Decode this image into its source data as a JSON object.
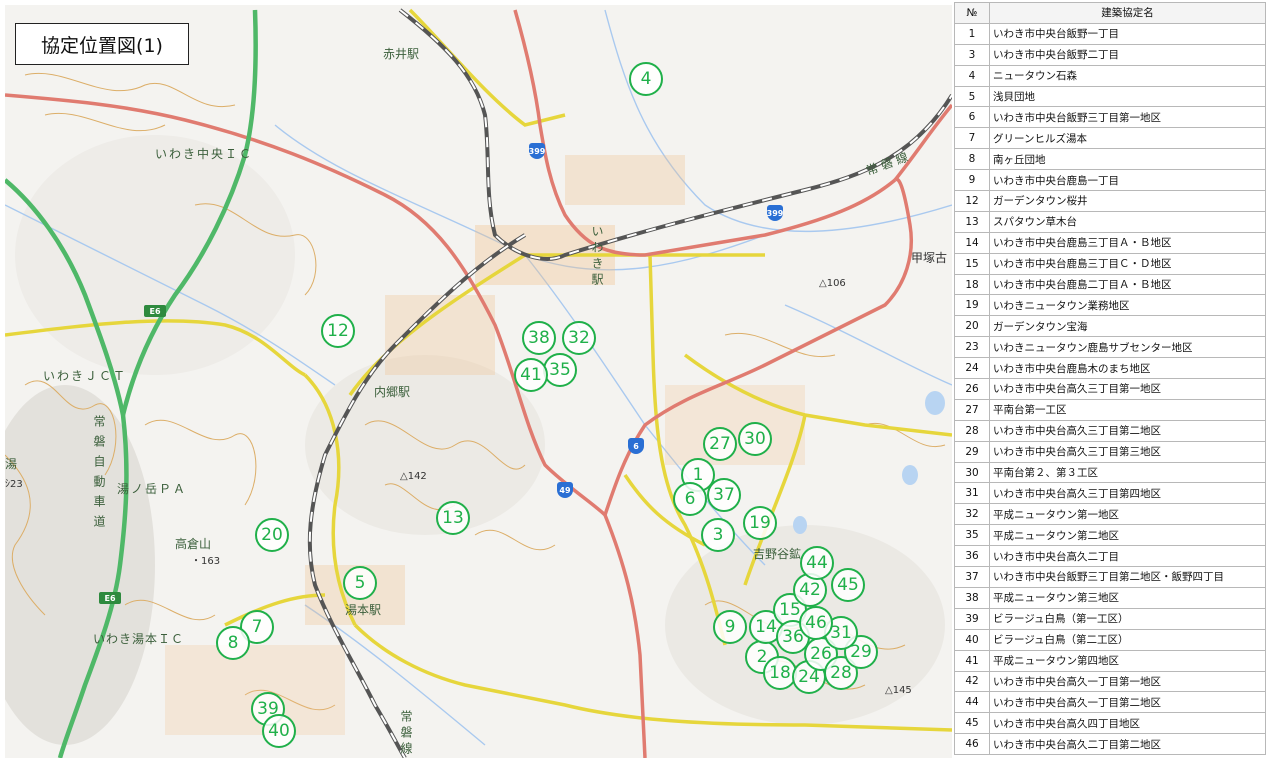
{
  "map": {
    "title": "協定位置図(1)",
    "place_labels": [
      {
        "id": "akai-station",
        "text": "赤井駅"
      },
      {
        "id": "iwaki-chuo-ic",
        "text": "いわき中央ＩＣ"
      },
      {
        "id": "iwaki-jct",
        "text": "いわきＪＣＴ"
      },
      {
        "id": "iwaki-station",
        "text": "いわき駅"
      },
      {
        "id": "uchigo-station",
        "text": "内郷駅"
      },
      {
        "id": "yunotake-pa",
        "text": "湯ノ岳ＰＡ"
      },
      {
        "id": "takakurayama",
        "text": "高倉山"
      },
      {
        "id": "yumoto-station",
        "text": "湯本駅"
      },
      {
        "id": "iwaki-yumoto-ic",
        "text": "いわき湯本ＩＣ"
      },
      {
        "id": "kozukako-station",
        "text": "甲塚古"
      },
      {
        "id": "yoshinoya",
        "text": "吉野谷鉱"
      },
      {
        "id": "joban-line-east",
        "text": "常 磐 線"
      },
      {
        "id": "joban-line-south",
        "text": "常磐線"
      },
      {
        "id": "expressway",
        "text": "常磐自動車道"
      },
      {
        "id": "yu-label",
        "text": "湯"
      },
      {
        "id": "elev-106",
        "text": "106"
      },
      {
        "id": "elev-142",
        "text": "142"
      },
      {
        "id": "elev-163",
        "text": "163"
      },
      {
        "id": "elev-145",
        "text": "145"
      },
      {
        "id": "elev-23",
        "text": "23"
      }
    ],
    "route_shields": [
      {
        "id": "r399-north",
        "text": "399",
        "kind": "national"
      },
      {
        "id": "r399-east",
        "text": "399",
        "kind": "national"
      },
      {
        "id": "r6",
        "text": "6",
        "kind": "national"
      },
      {
        "id": "r49",
        "text": "49",
        "kind": "national"
      },
      {
        "id": "e6-north",
        "text": "E6",
        "kind": "expressway"
      },
      {
        "id": "e6-south",
        "text": "E6",
        "kind": "expressway"
      }
    ],
    "markers": [
      "1",
      "2",
      "3",
      "4",
      "5",
      "6",
      "7",
      "8",
      "9",
      "12",
      "13",
      "14",
      "15",
      "18",
      "19",
      "20",
      "24",
      "26",
      "27",
      "28",
      "29",
      "30",
      "31",
      "32",
      "35",
      "36",
      "37",
      "38",
      "39",
      "40",
      "41",
      "42",
      "44",
      "45",
      "46"
    ]
  },
  "table": {
    "header_no": "№",
    "header_name": "建築協定名",
    "rows": [
      {
        "no": "1",
        "name": "いわき市中央台飯野一丁目"
      },
      {
        "no": "3",
        "name": "いわき市中央台飯野二丁目"
      },
      {
        "no": "4",
        "name": "ニュータウン石森"
      },
      {
        "no": "5",
        "name": "浅貝団地"
      },
      {
        "no": "6",
        "name": "いわき市中央台飯野三丁目第一地区"
      },
      {
        "no": "7",
        "name": "グリーンヒルズ湯本"
      },
      {
        "no": "8",
        "name": "南ヶ丘団地"
      },
      {
        "no": "9",
        "name": "いわき市中央台鹿島一丁目"
      },
      {
        "no": "12",
        "name": "ガーデンタウン桜井"
      },
      {
        "no": "13",
        "name": "スパタウン草木台"
      },
      {
        "no": "14",
        "name": "いわき市中央台鹿島三丁目Ａ・Ｂ地区"
      },
      {
        "no": "15",
        "name": "いわき市中央台鹿島三丁目Ｃ・Ｄ地区"
      },
      {
        "no": "18",
        "name": "いわき市中央台鹿島二丁目Ａ・Ｂ地区"
      },
      {
        "no": "19",
        "name": "いわきニュータウン業務地区"
      },
      {
        "no": "20",
        "name": "ガーデンタウン宝海"
      },
      {
        "no": "23",
        "name": "いわきニュータウン鹿島サブセンター地区"
      },
      {
        "no": "24",
        "name": "いわき市中央台鹿島木のまち地区"
      },
      {
        "no": "26",
        "name": "いわき市中央台高久三丁目第一地区"
      },
      {
        "no": "27",
        "name": "平南台第一工区"
      },
      {
        "no": "28",
        "name": "いわき市中央台高久三丁目第二地区"
      },
      {
        "no": "29",
        "name": "いわき市中央台高久三丁目第三地区"
      },
      {
        "no": "30",
        "name": "平南台第２、第３工区"
      },
      {
        "no": "31",
        "name": "いわき市中央台高久三丁目第四地区"
      },
      {
        "no": "32",
        "name": "平成ニュータウン第一地区"
      },
      {
        "no": "35",
        "name": "平成ニュータウン第二地区"
      },
      {
        "no": "36",
        "name": "いわき市中央台高久二丁目"
      },
      {
        "no": "37",
        "name": "いわき市中央台飯野三丁目第二地区・飯野四丁目"
      },
      {
        "no": "38",
        "name": "平成ニュータウン第三地区"
      },
      {
        "no": "39",
        "name": "ビラージュ白鳥（第一工区）"
      },
      {
        "no": "40",
        "name": "ビラージュ白鳥（第二工区）"
      },
      {
        "no": "41",
        "name": "平成ニュータウン第四地区"
      },
      {
        "no": "42",
        "name": "いわき市中央台高久一丁目第一地区"
      },
      {
        "no": "44",
        "name": "いわき市中央台高久一丁目第二地区"
      },
      {
        "no": "45",
        "name": "いわき市中央台高久四丁目地区"
      },
      {
        "no": "46",
        "name": "いわき市中央台高久二丁目第二地区"
      }
    ]
  },
  "colors": {
    "marker": "#20b04a",
    "national_road": "#e07b70",
    "prefectural_road": "#f0e24a",
    "expressway": "#2e9a4a",
    "railway": "#555555",
    "river": "#9fc3ec",
    "contour": "#d9a85a"
  }
}
